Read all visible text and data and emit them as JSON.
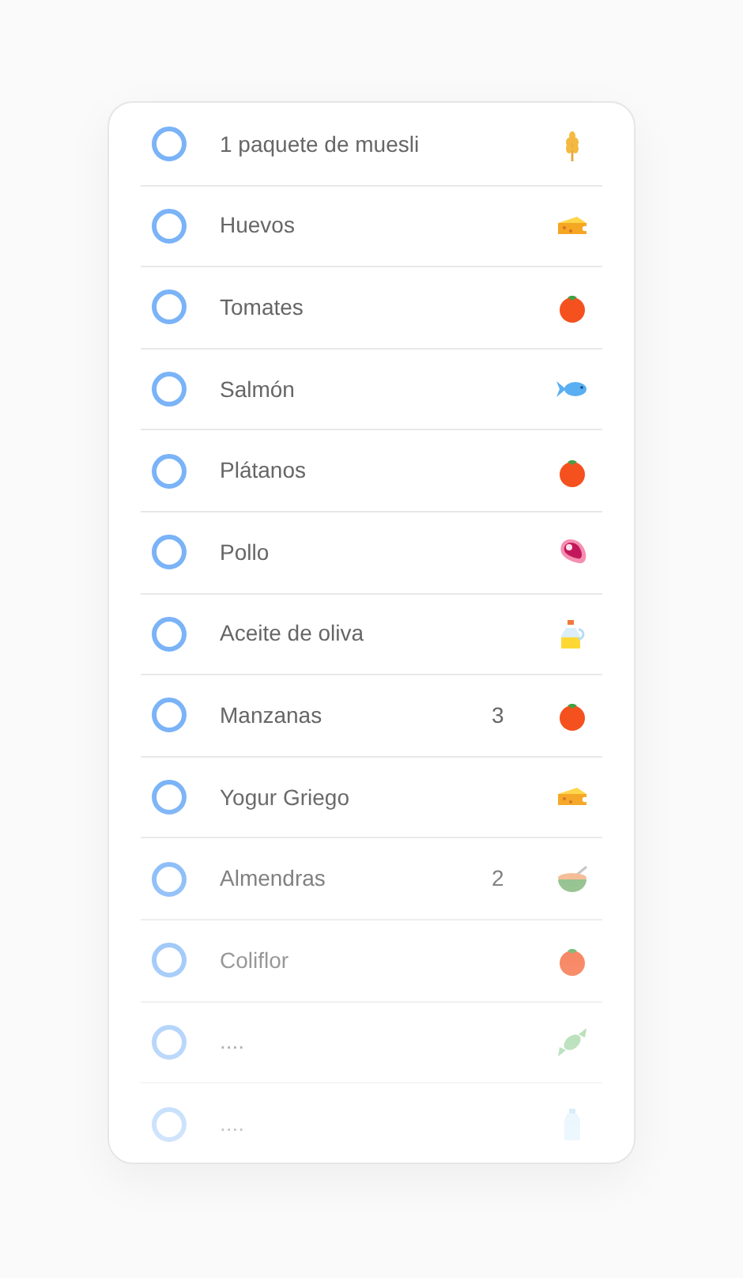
{
  "items": [
    {
      "label": "1 paquete de muesli",
      "checked": false,
      "kind": "wheat"
    },
    {
      "label": "Huevos",
      "checked": false,
      "kind": "cheese"
    },
    {
      "label": "Tomates",
      "checked": false,
      "kind": "tomato"
    },
    {
      "label": "Salmón",
      "checked": false,
      "kind": "fish"
    },
    {
      "label": "Plátanos",
      "checked": false,
      "kind": "tomato"
    },
    {
      "label": "Pollo",
      "checked": false,
      "kind": "meat"
    },
    {
      "label": "Aceite de oliva",
      "checked": false,
      "kind": "oil"
    },
    {
      "label": "Manzanas",
      "quantity": "3",
      "checked": false,
      "kind": "tomato"
    },
    {
      "label": "Yogur Griego",
      "checked": false,
      "kind": "cheese"
    },
    {
      "label": "Almendras",
      "quantity": "2",
      "checked": false,
      "kind": "bowl"
    },
    {
      "label": "Coliflor",
      "checked": false,
      "kind": "tomato"
    },
    {
      "label": "....",
      "checked": false,
      "kind": "candy"
    },
    {
      "label": "....",
      "checked": false,
      "kind": "bottle"
    }
  ]
}
